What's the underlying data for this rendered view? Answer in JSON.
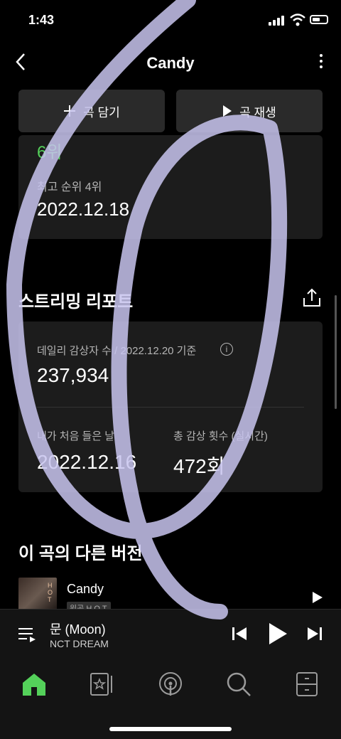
{
  "status_bar": {
    "time": "1:43"
  },
  "header": {
    "title": "Candy"
  },
  "actions": {
    "add_label": "곡 담기",
    "play_label": "곡 재생"
  },
  "chart_card": {
    "rank": "6위",
    "best_rank_label": "최고 순위 4위",
    "best_rank_date": "2022.12.18"
  },
  "streaming_report": {
    "title": "스트리밍 리포트",
    "daily_listeners_label": "데일리 감상자 수 / 2022.12.20 기준",
    "daily_listeners_value": "237,934",
    "first_listen_label": "내가 처음 들은 날",
    "first_listen_value": "2022.12.16",
    "total_plays_label": "총 감상 횟수 (실시간)",
    "total_plays_value": "472회"
  },
  "other_versions": {
    "title": "이 곡의 다른 버전",
    "items": [
      {
        "title": "Candy",
        "tag": "원곡",
        "artist": "H.O.T."
      }
    ]
  },
  "now_playing": {
    "title": "문 (Moon)",
    "artist": "NCT DREAM"
  },
  "tabs": [
    {
      "icon": "home-icon",
      "active": true
    },
    {
      "icon": "library-icon"
    },
    {
      "icon": "podcast-icon"
    },
    {
      "icon": "search-icon"
    },
    {
      "icon": "locker-icon"
    }
  ],
  "colors": {
    "accent": "#54d15a",
    "background": "#000000",
    "card": "#1c1c1c",
    "annotation_stroke": "#c8c4ee"
  }
}
